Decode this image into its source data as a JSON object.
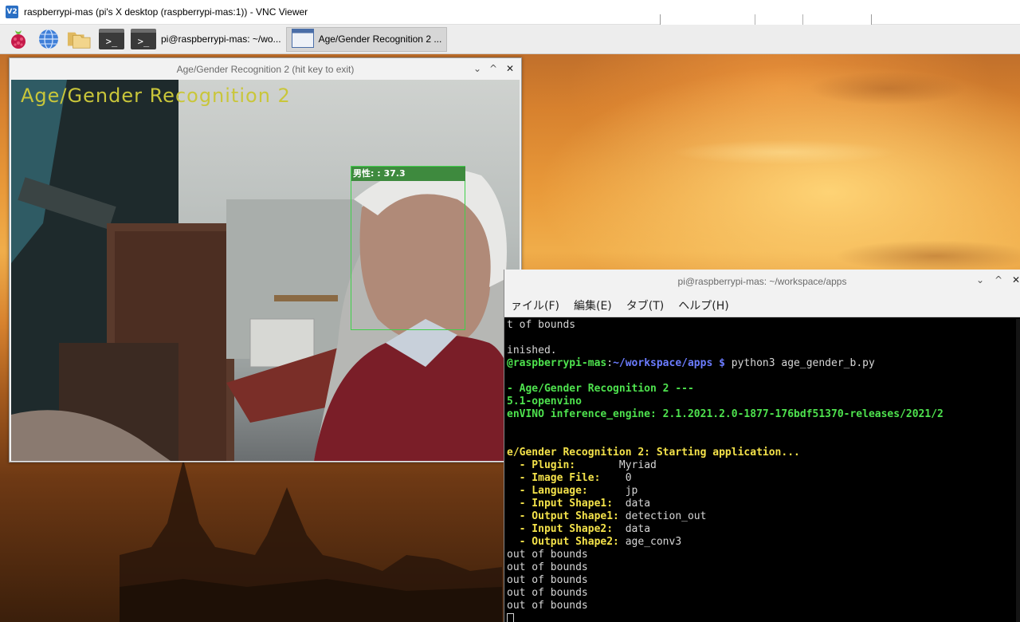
{
  "vnc": {
    "title": "raspberrypi-mas (pi's X desktop (raspberrypi-mas:1)) - VNC Viewer",
    "logo_text": "V2"
  },
  "taskbar": {
    "items": [
      {
        "label": "pi@raspberrypi-mas: ~/wo..."
      },
      {
        "label": "Age/Gender Recognition 2 ..."
      }
    ]
  },
  "camera_window": {
    "title": "Age/Gender Recognition 2  (hit key to exit)",
    "overlay_title": "Age/Gender Recognition 2",
    "face_label": "男性: : 37.3",
    "controls": [
      "⌄",
      "^",
      "✕"
    ]
  },
  "terminal_window": {
    "title": "pi@raspberrypi-mas: ~/workspace/apps",
    "controls": [
      "⌄",
      "^",
      "✕"
    ],
    "menu": [
      "ァイル(F)",
      "編集(E)",
      "タブ(T)",
      "ヘルプ(H)"
    ],
    "lines": {
      "l1": "t of bounds",
      "l2": "",
      "l3": "inished.",
      "l4_host": "@raspberrypi-mas",
      "l4_sep": ":",
      "l4_path": "~/workspace/apps $",
      "l4_cmd": " python3 age_gender_b.py",
      "l5": "",
      "l6": "- Age/Gender Recognition 2 ---",
      "l7": "5.1-openvino",
      "l8": "enVINO inference_engine: 2.1.2021.2.0-1877-176bdf51370-releases/2021/2",
      "l9": "",
      "l10": "",
      "l11": "e/Gender Recognition 2: Starting application...",
      "params": [
        {
          "key": "  - Plugin:",
          "pad": "       ",
          "value": "Myriad"
        },
        {
          "key": "  - Image File:",
          "pad": "    ",
          "value": "0"
        },
        {
          "key": "  - Language:",
          "pad": "      ",
          "value": "jp"
        },
        {
          "key": "  - Input Shape1:",
          "pad": "  ",
          "value": "data"
        },
        {
          "key": "  - Output Shape1:",
          "pad": " ",
          "value": "detection_out"
        },
        {
          "key": "  - Input Shape2:",
          "pad": "  ",
          "value": "data"
        },
        {
          "key": "  - Output Shape2:",
          "pad": " ",
          "value": "age_conv3"
        }
      ],
      "tail": [
        "out of bounds",
        "out of bounds",
        "out of bounds",
        "out of bounds",
        "out of bounds"
      ]
    }
  },
  "colors": {
    "terminal_green": "#4ee24e",
    "terminal_blue": "#6b7cff",
    "terminal_yellow": "#f4e24a",
    "face_box": "#3fd04a",
    "overlay_title": "#c9c63a"
  }
}
